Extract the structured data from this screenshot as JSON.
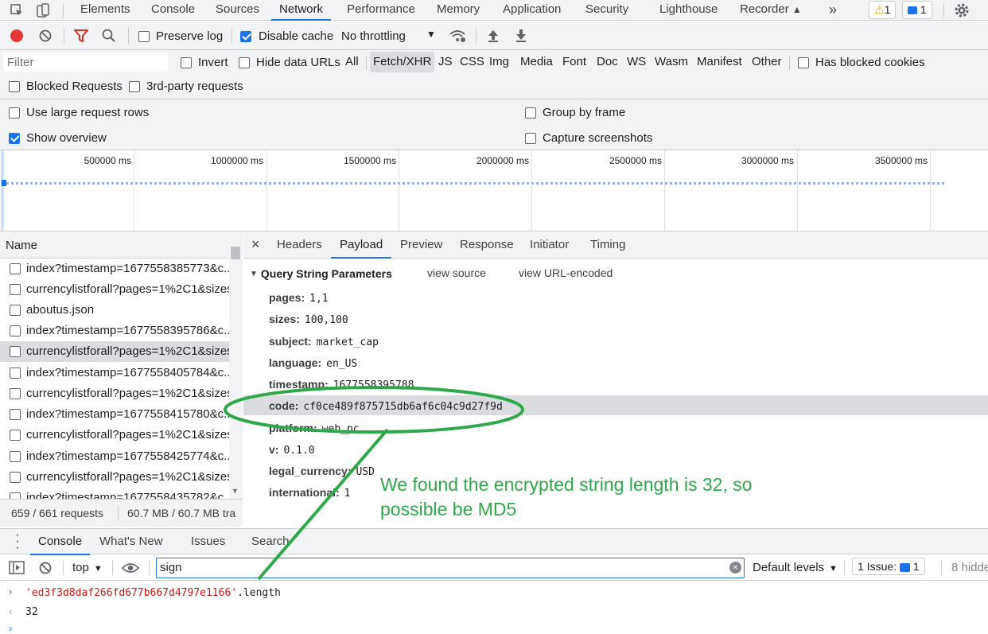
{
  "tabs": [
    "Elements",
    "Console",
    "Sources",
    "Network",
    "Performance",
    "Memory",
    "Application",
    "Security",
    "Lighthouse",
    "Recorder"
  ],
  "more_tabs_icon": "double-chevron-right-icon",
  "warning_count": "1",
  "issue_count": "1",
  "toolbar": {
    "preserve_log": "Preserve log",
    "disable_cache": "Disable cache",
    "throttling": "No throttling"
  },
  "filter": {
    "placeholder": "Filter",
    "invert": "Invert",
    "hide_data_urls": "Hide data URLs",
    "types": [
      "All",
      "Fetch/XHR",
      "JS",
      "CSS",
      "Img",
      "Media",
      "Font",
      "Doc",
      "WS",
      "Wasm",
      "Manifest",
      "Other"
    ],
    "has_blocked_cookies": "Has blocked cookies",
    "blocked_requests": "Blocked Requests",
    "third_party": "3rd-party requests"
  },
  "settings": {
    "large_rows": "Use large request rows",
    "group_by_frame": "Group by frame",
    "show_overview": "Show overview",
    "capture_screenshots": "Capture screenshots"
  },
  "overview": {
    "ticks": [
      "500000 ms",
      "1000000 ms",
      "1500000 ms",
      "2000000 ms",
      "2500000 ms",
      "3000000 ms",
      "3500000 ms"
    ]
  },
  "requests": {
    "header": "Name",
    "rows": [
      "index?timestamp=1677558385773&c...",
      "currencylistforall?pages=1%2C1&sizes",
      "aboutus.json",
      "index?timestamp=1677558395786&c...",
      "currencylistforall?pages=1%2C1&sizes",
      "index?timestamp=1677558405784&c...",
      "currencylistforall?pages=1%2C1&sizes",
      "index?timestamp=1677558415780&c...",
      "currencylistforall?pages=1%2C1&sizes",
      "index?timestamp=1677558425774&c...",
      "currencylistforall?pages=1%2C1&sizes",
      "index?timestamp=1677558435782&c..."
    ],
    "selected_index": 4,
    "status_requests": "659 / 661 requests",
    "status_size": "60.7 MB / 60.7 MB tra"
  },
  "details": {
    "tabs": [
      "Headers",
      "Payload",
      "Preview",
      "Response",
      "Initiator",
      "Timing"
    ],
    "section_title": "Query String Parameters",
    "view_source": "view source",
    "view_url_encoded": "view URL-encoded",
    "params": [
      {
        "key": "pages:",
        "value": "1,1"
      },
      {
        "key": "sizes:",
        "value": "100,100"
      },
      {
        "key": "subject:",
        "value": "market_cap"
      },
      {
        "key": "language:",
        "value": "en_US"
      },
      {
        "key": "timestamp:",
        "value": "1677558395788"
      },
      {
        "key": "code:",
        "value": "cf0ce489f875715db6af6c04c9d27f9d"
      },
      {
        "key": "platform:",
        "value": "web_pc"
      },
      {
        "key": "v:",
        "value": "0.1.0"
      },
      {
        "key": "legal_currency:",
        "value": "USD"
      },
      {
        "key": "international:",
        "value": "1"
      }
    ],
    "highlighted_index": 5
  },
  "annotation": {
    "line1": "We found the encrypted string length is 32, so",
    "line2": "possible be MD5"
  },
  "console": {
    "tabs": [
      "Console",
      "What's New",
      "Issues",
      "Search"
    ],
    "context": "top",
    "filter_value": "sign",
    "levels": "Default levels",
    "issue_label": "1 Issue:",
    "issue_count": "1",
    "hidden": "8 hidde",
    "input_line": "'ed3f3d8daf266fd677b667d4797e1166'",
    "input_suffix": ".length",
    "output": "32"
  }
}
